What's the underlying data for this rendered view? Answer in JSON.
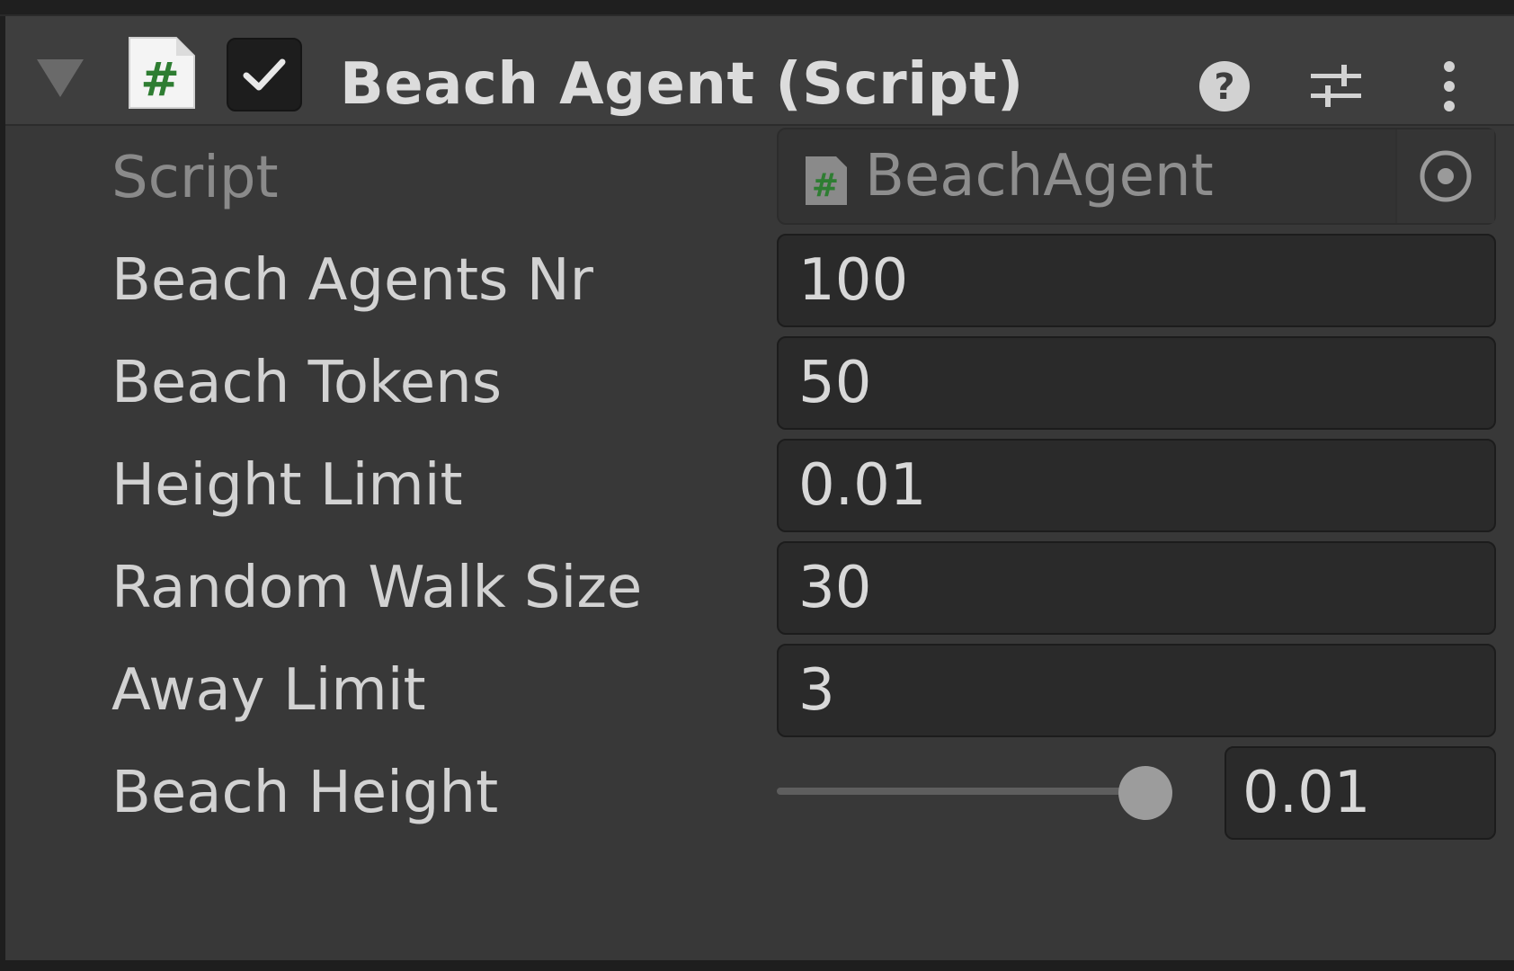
{
  "component": {
    "title": "Beach Agent (Script)",
    "enabled": true,
    "icons": {
      "foldout": "triangle-down-icon",
      "script": "csharp-script-icon",
      "help": "help-icon",
      "presets": "presets-icon",
      "menu": "kebab-menu-icon"
    }
  },
  "fields": {
    "script": {
      "label": "Script",
      "value": "BeachAgent"
    },
    "beach_agents_nr": {
      "label": "Beach Agents Nr",
      "value": "100"
    },
    "beach_tokens": {
      "label": "Beach Tokens",
      "value": "50"
    },
    "height_limit": {
      "label": "Height Limit",
      "value": "0.01"
    },
    "random_walk_size": {
      "label": "Random Walk Size",
      "value": "30"
    },
    "away_limit": {
      "label": "Away Limit",
      "value": "3"
    },
    "beach_height": {
      "label": "Beach Height",
      "value": "0.01",
      "slider_fraction": 1.0
    }
  },
  "colors": {
    "panel_bg": "#383838",
    "header_bg": "#3e3e3e",
    "field_bg": "#2a2a2a",
    "script_icon_green": "#2e7d32"
  }
}
